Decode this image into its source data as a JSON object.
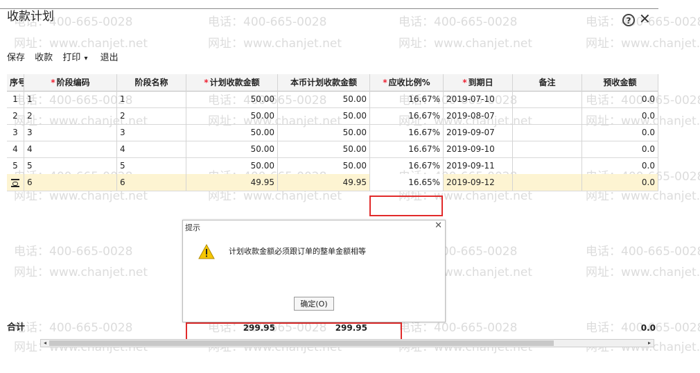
{
  "window": {
    "title": "收款计划",
    "help_icon": "question-icon",
    "close_icon": "close-icon"
  },
  "toolbar": {
    "save": "保存",
    "collect": "收款",
    "print": "打印",
    "exit": "退出"
  },
  "table": {
    "headers": {
      "seq": "序号",
      "stage_code": "阶段编码",
      "stage_name": "阶段名称",
      "plan_amount": "计划收款金额",
      "local_amount": "本币计划收款金额",
      "ratio": "应收比例%",
      "due_date": "到期日",
      "note": "备注",
      "prepay": "预收金额"
    },
    "rows": [
      {
        "seq": "1",
        "code": "1",
        "name": "1",
        "plan": "50.00",
        "local": "50.00",
        "ratio": "16.67%",
        "due": "2019-07-10",
        "note": "",
        "prepay": "0.0"
      },
      {
        "seq": "2",
        "code": "2",
        "name": "2",
        "plan": "50.00",
        "local": "50.00",
        "ratio": "16.67%",
        "due": "2019-08-07",
        "note": "",
        "prepay": "0.0"
      },
      {
        "seq": "3",
        "code": "3",
        "name": "3",
        "plan": "50.00",
        "local": "50.00",
        "ratio": "16.67%",
        "due": "2019-09-07",
        "note": "",
        "prepay": "0.0"
      },
      {
        "seq": "4",
        "code": "4",
        "name": "4",
        "plan": "50.00",
        "local": "50.00",
        "ratio": "16.67%",
        "due": "2019-09-10",
        "note": "",
        "prepay": "0.0"
      },
      {
        "seq": "5",
        "code": "5",
        "name": "5",
        "plan": "50.00",
        "local": "50.00",
        "ratio": "16.67%",
        "due": "2019-09-11",
        "note": "",
        "prepay": "0.0"
      },
      {
        "seq": "",
        "code": "6",
        "name": "6",
        "plan": "49.95",
        "local": "49.95",
        "ratio": "16.65%",
        "due": "2019-09-12",
        "note": "",
        "prepay": "0.0"
      }
    ],
    "footer": {
      "label": "合计",
      "plan_total": "299.95",
      "local_total": "299.95",
      "prepay_total": "0.0"
    }
  },
  "dialog": {
    "title": "提示",
    "message": "计划收款金额必须跟订单的整单金额相等",
    "ok_button": "确定(O)",
    "icon": "warning-icon"
  },
  "watermark": {
    "phone": "电话：400-665-0028",
    "site": "网址：www.chanjet.net"
  },
  "colors": {
    "highlight_border": "#e12a2a",
    "selected_row": "#fdf4d2",
    "required_mark": "#e23"
  }
}
